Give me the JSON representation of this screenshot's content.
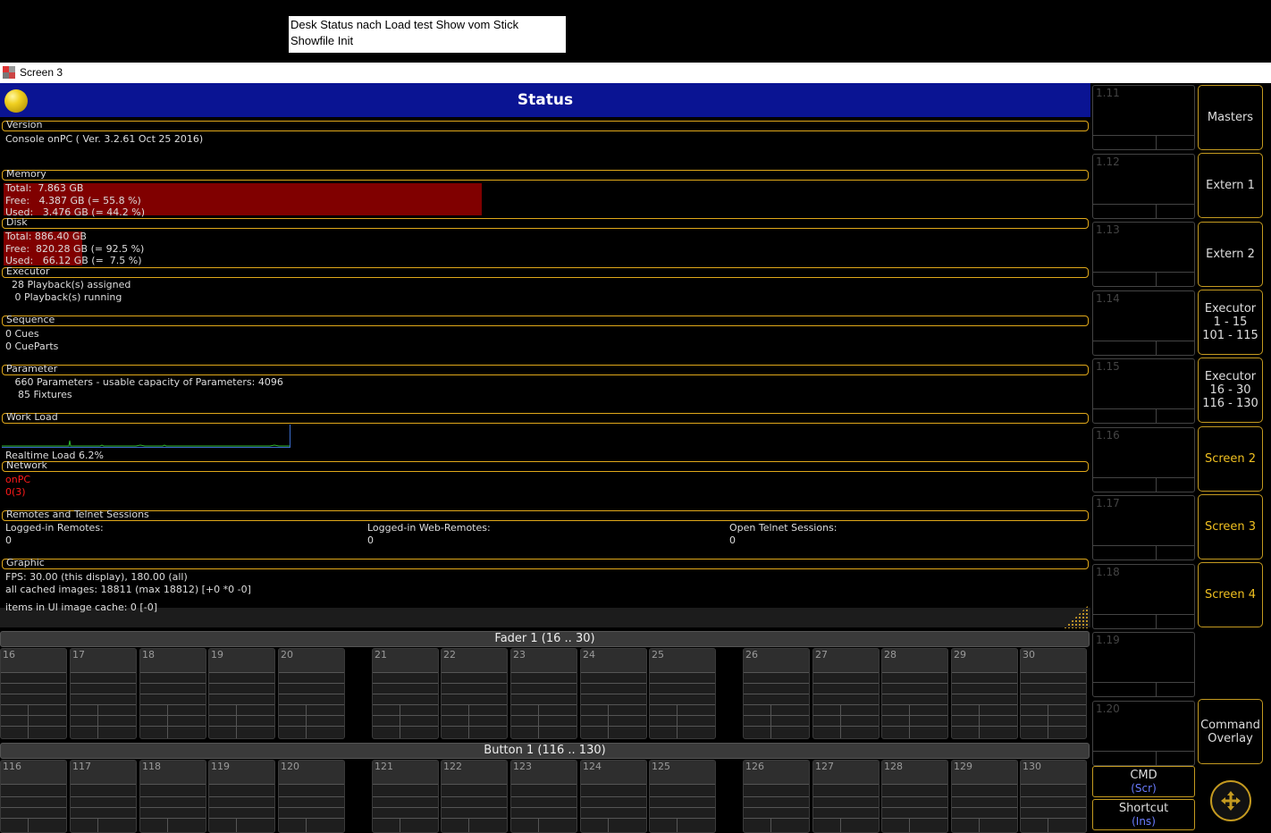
{
  "annotation": {
    "line1": "Desk Status nach Load test Show vom Stick",
    "line2": "Showfile Init"
  },
  "window": {
    "title": "Screen 3",
    "icon": "app-icon"
  },
  "status": {
    "title": "Status",
    "sections": {
      "version": {
        "label": "Version",
        "lines": [
          "Console onPC ( Ver. 3.2.61 Oct 25 2016)"
        ]
      },
      "memory": {
        "label": "Memory",
        "lines": [
          "Total:  7.863 GB",
          "Free:   4.387 GB (= 55.8 %)",
          "Used:   3.476 GB (= 44.2 %)"
        ]
      },
      "disk": {
        "label": "Disk",
        "lines": [
          "Total: 886.40 GB",
          "Free:  820.28 GB (= 92.5 %)",
          "Used:   66.12 GB (=  7.5 %)"
        ]
      },
      "executor": {
        "label": "Executor",
        "lines": [
          "  28 Playback(s) assigned",
          "   0 Playback(s) running"
        ]
      },
      "sequence": {
        "label": "Sequence",
        "lines": [
          "0 Cues",
          "0 CueParts"
        ]
      },
      "parameter": {
        "label": "Parameter",
        "lines": [
          "   660 Parameters - usable capacity of Parameters: 4096",
          "    85 Fixtures"
        ]
      },
      "workload": {
        "label": "Work Load",
        "realtime": "Realtime Load 6.2%"
      },
      "network": {
        "label": "Network",
        "lines": [
          "onPC",
          "0(3)"
        ]
      },
      "remotes": {
        "label": "Remotes and Telnet Sessions",
        "cols": [
          {
            "title": "Logged-in Remotes:",
            "value": "0"
          },
          {
            "title": "Logged-in Web-Remotes:",
            "value": "0"
          },
          {
            "title": "Open Telnet Sessions:",
            "value": "0"
          }
        ]
      },
      "graphic": {
        "label": "Graphic",
        "lines": [
          "FPS: 30.00 (this display), 180.00 (all)",
          "all cached images: 18811 (max 18812) [+0 *0 -0]",
          "items in UI image cache: 0 [-0]"
        ]
      }
    }
  },
  "fader_bank": {
    "title": "Fader  1 (16 .. 30)",
    "numbers": [
      "16",
      "17",
      "18",
      "19",
      "20",
      "21",
      "22",
      "23",
      "24",
      "25",
      "26",
      "27",
      "28",
      "29",
      "30"
    ]
  },
  "button_bank": {
    "title": "Button  1 (116 .. 130)",
    "numbers": [
      "116",
      "117",
      "118",
      "119",
      "120",
      "121",
      "122",
      "123",
      "124",
      "125",
      "126",
      "127",
      "128",
      "129",
      "130"
    ]
  },
  "executors": [
    "1.11",
    "1.12",
    "1.13",
    "1.14",
    "1.15",
    "1.16",
    "1.17",
    "1.18",
    "1.19",
    "1.20"
  ],
  "view_buttons": [
    {
      "label": "Masters",
      "active": false
    },
    {
      "label": "Extern 1",
      "active": false
    },
    {
      "label": "Extern 2",
      "active": false
    },
    {
      "label": "Executor\n1 - 15\n101 - 115",
      "active": false
    },
    {
      "label": "Executor\n16 - 30\n116 - 130",
      "active": false
    },
    {
      "label": "Screen 2",
      "active": true
    },
    {
      "label": "Screen 3",
      "active": true
    },
    {
      "label": "Screen 4",
      "active": true
    },
    {
      "label": "Command\nOverlay",
      "active": false
    }
  ],
  "cmd_button": {
    "label": "CMD",
    "sub": "(Scr)"
  },
  "shortcut_button": {
    "label": "Shortcut",
    "sub": "(Ins)"
  },
  "colors": {
    "accent": "#c49a20",
    "header_blue": "#0a1493",
    "alert_red": "#800000"
  }
}
